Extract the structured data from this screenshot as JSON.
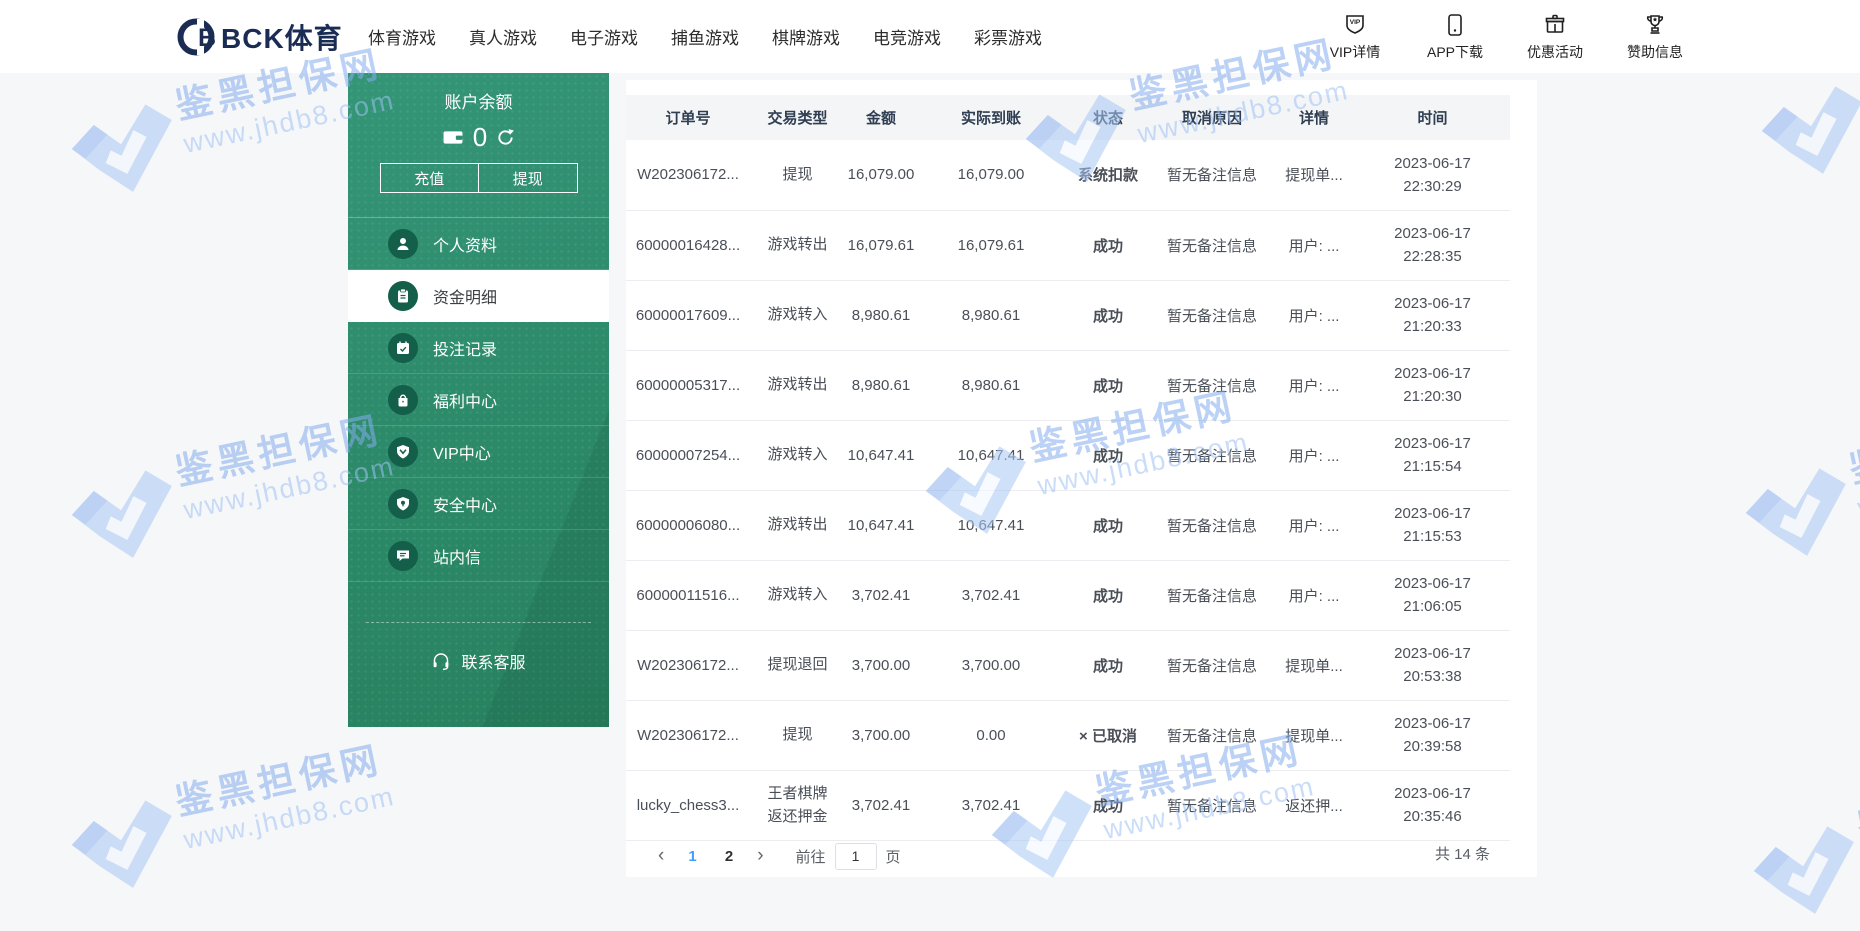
{
  "nav": {
    "logo_text": "BCK体育",
    "menu": [
      "体育游戏",
      "真人游戏",
      "电子游戏",
      "捕鱼游戏",
      "棋牌游戏",
      "电竞游戏",
      "彩票游戏"
    ],
    "quick_links": [
      {
        "icon": "vip-badge-icon",
        "label": "VIP详情"
      },
      {
        "icon": "phone-icon",
        "label": "APP下载"
      },
      {
        "icon": "gift-box-icon",
        "label": "优惠活动"
      },
      {
        "icon": "trophy-icon",
        "label": "赞助信息"
      }
    ]
  },
  "sidebar": {
    "balance_title": "账户余额",
    "balance_value": "0",
    "recharge_label": "充值",
    "withdraw_label": "提现",
    "menu": [
      {
        "icon": "person-icon",
        "label": "个人资料",
        "selected": false
      },
      {
        "icon": "clipboard-icon",
        "label": "资金明细",
        "selected": true
      },
      {
        "icon": "calendar-check-icon",
        "label": "投注记录",
        "selected": false
      },
      {
        "icon": "gift-bag-icon",
        "label": "福利中心",
        "selected": false
      },
      {
        "icon": "vip-shield-icon",
        "label": "VIP中心",
        "selected": false
      },
      {
        "icon": "security-shield-icon",
        "label": "安全中心",
        "selected": false
      },
      {
        "icon": "message-icon",
        "label": "站内信",
        "selected": false
      }
    ],
    "contact_label": "联系客服"
  },
  "table": {
    "headers": [
      "订单号",
      "交易类型",
      "金额",
      "实际到账",
      "状态",
      "取消原因",
      "详情",
      "时间"
    ],
    "rows": [
      {
        "order": "W202306172...",
        "type": "提现",
        "amount": "16,079.00",
        "actual": "16,079.00",
        "status": "系统扣款",
        "status_class": "status-green",
        "cancel_reason": "暂无备注信息",
        "detail": "提现单...",
        "time": "2023-06-17\n22:30:29"
      },
      {
        "order": "60000016428...",
        "type": "游戏转出",
        "amount": "16,079.61",
        "actual": "16,079.61",
        "status": "成功",
        "status_class": "status-green",
        "cancel_reason": "暂无备注信息",
        "detail": "用户: ...",
        "time": "2023-06-17\n22:28:35"
      },
      {
        "order": "60000017609...",
        "type": "游戏转入",
        "amount": "8,980.61",
        "actual": "8,980.61",
        "status": "成功",
        "status_class": "status-green",
        "cancel_reason": "暂无备注信息",
        "detail": "用户: ...",
        "time": "2023-06-17\n21:20:33"
      },
      {
        "order": "60000005317...",
        "type": "游戏转出",
        "amount": "8,980.61",
        "actual": "8,980.61",
        "status": "成功",
        "status_class": "status-green",
        "cancel_reason": "暂无备注信息",
        "detail": "用户: ...",
        "time": "2023-06-17\n21:20:30"
      },
      {
        "order": "60000007254...",
        "type": "游戏转入",
        "amount": "10,647.41",
        "actual": "10,647.41",
        "status": "成功",
        "status_class": "status-green",
        "cancel_reason": "暂无备注信息",
        "detail": "用户: ...",
        "time": "2023-06-17\n21:15:54"
      },
      {
        "order": "60000006080...",
        "type": "游戏转出",
        "amount": "10,647.41",
        "actual": "10,647.41",
        "status": "成功",
        "status_class": "status-green",
        "cancel_reason": "暂无备注信息",
        "detail": "用户: ...",
        "time": "2023-06-17\n21:15:53"
      },
      {
        "order": "60000011516...",
        "type": "游戏转入",
        "amount": "3,702.41",
        "actual": "3,702.41",
        "status": "成功",
        "status_class": "status-green",
        "cancel_reason": "暂无备注信息",
        "detail": "用户: ...",
        "time": "2023-06-17\n21:06:05"
      },
      {
        "order": "W202306172...",
        "type": "提现退回",
        "amount": "3,700.00",
        "actual": "3,700.00",
        "status": "成功",
        "status_class": "status-green",
        "cancel_reason": "暂无备注信息",
        "detail": "提现单...",
        "time": "2023-06-17\n20:53:38"
      },
      {
        "order": "W202306172...",
        "type": "提现",
        "amount": "3,700.00",
        "actual": "0.00",
        "status": "× 已取消",
        "status_class": "status-red",
        "cancel_reason": "暂无备注信息",
        "detail": "提现单...",
        "time": "2023-06-17\n20:39:58"
      },
      {
        "order": "lucky_chess3...",
        "type": "王者棋牌\n返还押金",
        "amount": "3,702.41",
        "actual": "3,702.41",
        "status": "成功",
        "status_class": "status-green",
        "cancel_reason": "暂无备注信息",
        "detail": "返还押...",
        "time": "2023-06-17\n20:35:46"
      }
    ]
  },
  "pagination": {
    "prev": "‹",
    "pages": [
      {
        "label": "1",
        "cls": "active"
      },
      {
        "label": "2",
        "cls": ""
      }
    ],
    "next": "›",
    "goto_label": "前往",
    "goto_value": "1",
    "unit_label": "页",
    "total_label": "共 14 条"
  },
  "watermark": {
    "line1": "鉴黑担保网",
    "line2": "www.jhdb8.com"
  },
  "colors": {
    "sidebar_green": "#2E8E6E",
    "sidebar_icon_green": "#135F4A",
    "status_success_green": "#18A15F",
    "status_cancel_red": "#DF2F2F",
    "pagination_active_blue": "#409EFF",
    "brand_navy": "#1A2C54",
    "watermark_blue": "#9BBDF2",
    "table_header_bg": "#F4F5F7",
    "table_header_text": "#2F3E52"
  }
}
